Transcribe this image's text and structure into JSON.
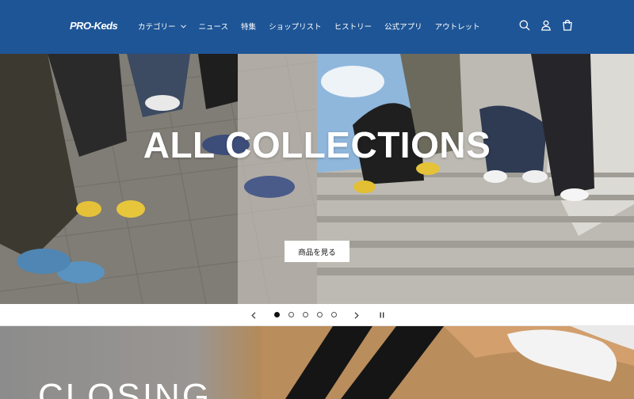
{
  "header": {
    "logo": "PRO-Keds",
    "nav": [
      "カテゴリー",
      "ニュース",
      "特集",
      "ショップリスト",
      "ヒストリー",
      "公式アプリ",
      "アウトレット"
    ],
    "icons": [
      "search-icon",
      "account-icon",
      "cart-icon"
    ]
  },
  "hero": {
    "title": "ALL COLLECTIONS",
    "button": "商品を見る"
  },
  "carousel": {
    "slide_count": 5,
    "active_slide": 1,
    "icons": [
      "previous-icon",
      "next-icon",
      "pause-icon"
    ]
  },
  "banner2": {
    "title": "CLOSING"
  },
  "colors": {
    "header_bg": "#1e5596",
    "text_on_header": "#ffffff"
  }
}
